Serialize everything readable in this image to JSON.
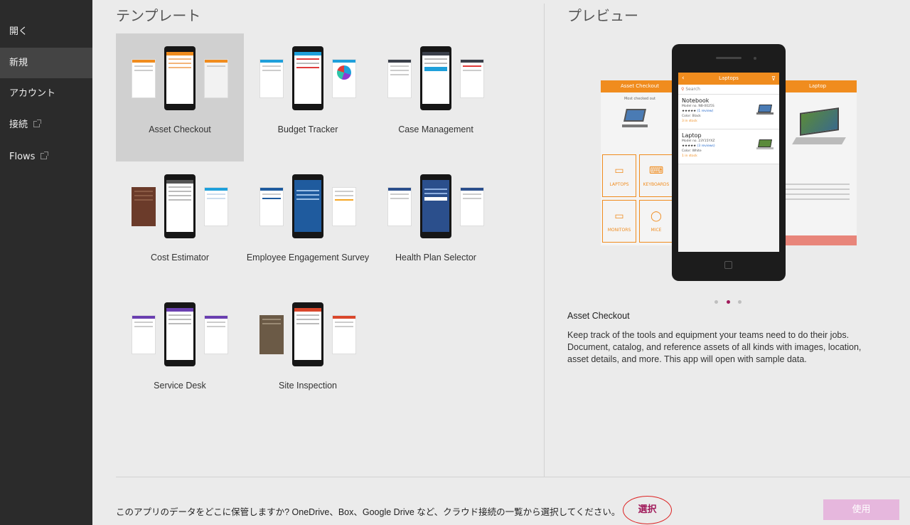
{
  "sidebar": {
    "items": [
      {
        "label": "開く"
      },
      {
        "label": "新規"
      },
      {
        "label": "アカウント"
      },
      {
        "label": "接続"
      },
      {
        "label": "Flows"
      }
    ]
  },
  "templates": {
    "heading": "テンプレート",
    "items": [
      {
        "label": "Asset Checkout"
      },
      {
        "label": "Budget Tracker"
      },
      {
        "label": "Case Management"
      },
      {
        "label": "Cost Estimator"
      },
      {
        "label": "Employee Engagement Survey"
      },
      {
        "label": "Health Plan Selector"
      },
      {
        "label": "Service Desk"
      },
      {
        "label": "Site Inspection"
      }
    ]
  },
  "preview": {
    "heading": "プレビュー",
    "left_title": "Asset Checkout",
    "left_subtitle": "Most checked out",
    "right_title": "Laptop",
    "screen_title": "Laptops",
    "search_placeholder": "Search",
    "items": [
      {
        "name": "Notebook",
        "model": "Model no. NB-0025S",
        "reviews": "(1 review)",
        "color": "Color: Black",
        "status": "3 in stock"
      },
      {
        "name": "Laptop",
        "model": "Model no. 23Y15YXZ",
        "reviews": "(3 reviews)",
        "color": "Color: White",
        "status": "1 in stock"
      }
    ],
    "tiles": [
      "LAPTOPS",
      "KEYBOARDS",
      "MONITORS",
      "MICE"
    ],
    "app_name": "Asset Checkout",
    "description": "Keep track of the tools and equipment your teams need to do their jobs. Document, catalog, and reference assets of all kinds with images, location, asset details, and more. This app will open with sample data."
  },
  "footer": {
    "question": "このアプリのデータをどこに保管しますか? OneDrive、Box、Google Drive など、クラウド接続の一覧から選択してください。",
    "select_label": "選択",
    "use_label": "使用"
  },
  "colors": {
    "accent": "#a01a5a",
    "orange": "#f08c1e",
    "sidebar": "#2b2b2b",
    "use_button": "#e6b7dd"
  }
}
